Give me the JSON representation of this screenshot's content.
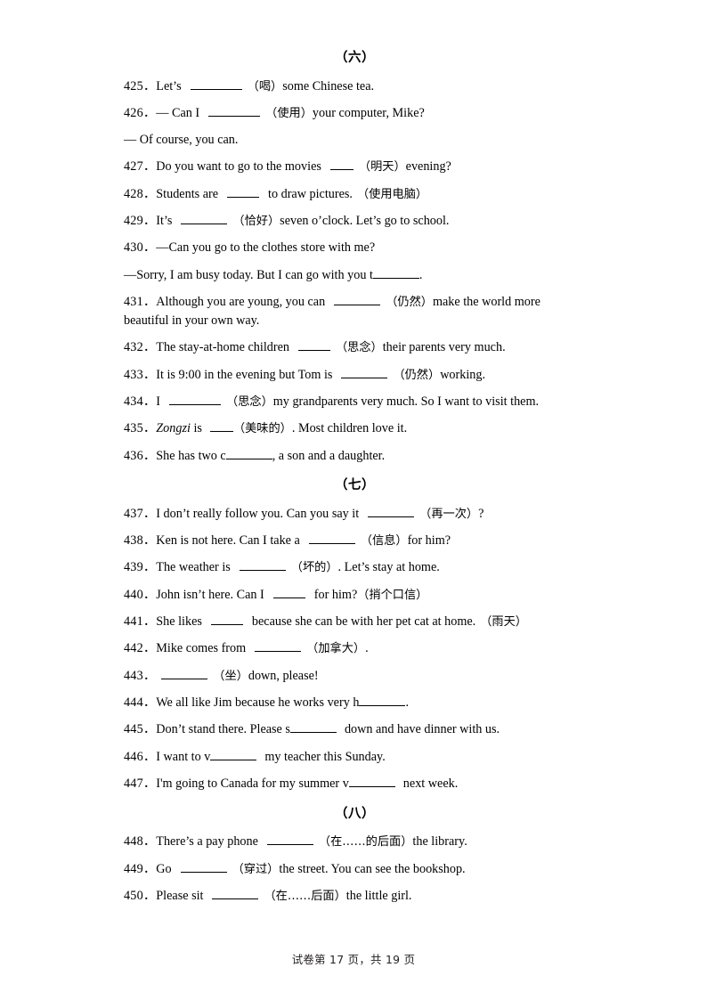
{
  "page": {
    "footer": "试卷第 17 页，共 19 页"
  },
  "sections": [
    {
      "header": "（六）",
      "items": [
        {
          "num": "425．",
          "pre": "Let’s",
          "blank": "b-xl",
          "post": "（喝）some Chinese tea."
        },
        {
          "num": "426．",
          "pre": "— Can I",
          "blank": "b-xl",
          "post": "（使用）your computer, Mike?"
        },
        {
          "num": "",
          "pre": "— Of course, you can.",
          "blank": "",
          "post": ""
        },
        {
          "num": "427．",
          "pre": "Do you want to go to the movies",
          "blank": "b-xs",
          "post": "（明天）evening?"
        },
        {
          "num": "428．",
          "pre": "Students are",
          "blank": "b-s",
          "post": "to draw pictures.（使用电脑）"
        },
        {
          "num": "429．",
          "pre": "It’s",
          "blank": "b-l",
          "post": "（恰好）seven o’clock. Let’s go to school."
        },
        {
          "num": "430．",
          "pre": "—Can you go to the clothes store with me?",
          "blank": "",
          "post": ""
        },
        {
          "num": "",
          "pre": "—Sorry, I am busy today. But I can go with you t",
          "blank": "b-l",
          "post": "."
        },
        {
          "num": "431．",
          "pre": "Although you are young, you can",
          "blank": "b-l",
          "post": "（仍然）make the world more beautiful in your own way."
        },
        {
          "num": "432．",
          "pre": "The stay-at-home children",
          "blank": "b-s",
          "post": "（思念）their parents very much."
        },
        {
          "num": "433．",
          "pre": "It is 9:00 in the evening but Tom is",
          "blank": "b-l",
          "post": "（仍然）working."
        },
        {
          "num": "434．",
          "pre": "I",
          "blank": "b-xl",
          "post": "（思念）my grandparents very much. So I want to visit them."
        },
        {
          "num": "435．",
          "pre": "Zongzi is",
          "blank": "b-xs",
          "post": "（美味的）. Most children love it."
        },
        {
          "num": "436．",
          "pre": "She has two c",
          "blank": "b-l",
          "post": ", a son and a daughter."
        }
      ]
    },
    {
      "header": "（七）",
      "items": [
        {
          "num": "437．",
          "pre": "I don’t really follow you. Can you say it",
          "blank": "b-l",
          "post": "（再一次）?"
        },
        {
          "num": "438．",
          "pre": "Ken is not here. Can I take a",
          "blank": "b-l",
          "post": "（信息）for him?"
        },
        {
          "num": "439．",
          "pre": "The weather is",
          "blank": "b-l",
          "post": "（坏的）. Let’s stay at home."
        },
        {
          "num": "440．",
          "pre": "John isn’t here. Can I",
          "blank": "b-s",
          "post": "for him?（捎个口信）"
        },
        {
          "num": "441．",
          "pre": "She likes",
          "blank": "b-s",
          "post": "because she can be with her pet cat at home.（雨天）"
        },
        {
          "num": "442．",
          "pre": "Mike comes from",
          "blank": "b-l",
          "post": "（加拿大）."
        },
        {
          "num": "443．",
          "pre": "",
          "blank": "b-l",
          "post": "（坐）down, please!"
        },
        {
          "num": "444．",
          "pre": "We all like Jim because he works very h",
          "blank": "b-l",
          "post": "."
        },
        {
          "num": "445．",
          "pre": "Don’t stand there. Please s",
          "blank": "b-l",
          "post": "down and have dinner with us."
        },
        {
          "num": "446．",
          "pre": "I want to v",
          "blank": "b-l",
          "post": "my teacher this Sunday."
        },
        {
          "num": "447．",
          "pre": "I'm going to Canada for my summer v",
          "blank": "b-l",
          "post": "next week."
        }
      ]
    },
    {
      "header": "（八）",
      "items": [
        {
          "num": "448．",
          "pre": "There’s a pay phone",
          "blank": "b-l",
          "post": "（在……的后面）the library."
        },
        {
          "num": "449．",
          "pre": "Go",
          "blank": "b-l",
          "post": "（穿过）the street. You can see the bookshop."
        },
        {
          "num": "450．",
          "pre": "Please sit",
          "blank": "b-l",
          "post": "（在……后面）the little girl."
        }
      ]
    }
  ],
  "lines": {
    "l425_num": "425．",
    "l425_a": "Let’s",
    "l425_b": "（喝）",
    "l425_c": "some Chinese tea.",
    "l426_num": "426．",
    "l426_a": "— Can I",
    "l426_b": "（使用）",
    "l426_c": "your computer, Mike?",
    "l426b": "— Of course, you can.",
    "l427_num": "427．",
    "l427_a": "Do you want to go to the movies",
    "l427_b": "（明天）",
    "l427_c": "evening?",
    "l428_num": "428．",
    "l428_a": "Students are",
    "l428_b": "to draw pictures.",
    "l428_c": "（使用电脑）",
    "l429_num": "429．",
    "l429_a": "It’s",
    "l429_b": "（恰好）",
    "l429_c": "seven o’clock. Let’s go to school.",
    "l430_num": "430．",
    "l430_a": "—Can you go to the clothes store with me?",
    "l430b_a": "—Sorry, I am busy today. But I can go with you t",
    "l430b_b": ".",
    "l431_num": "431．",
    "l431_a": "Although you are young, you can",
    "l431_b": "（仍然）",
    "l431_c": "make the world more beautiful in",
    "l431_d": "your own way.",
    "l432_num": "432．",
    "l432_a": "The stay-at-home children",
    "l432_b": "（思念）",
    "l432_c": "their parents very much.",
    "l433_num": "433．",
    "l433_a": "It is 9:00 in the evening but Tom is",
    "l433_b": "（仍然）",
    "l433_c": "working.",
    "l434_num": "434．",
    "l434_a": "I",
    "l434_b": "（思念）",
    "l434_c": "my grandparents very much. So I want to visit them.",
    "l435_num": "435．",
    "l435_a": "Zongzi",
    "l435_a2": "is",
    "l435_b": "（美味的）",
    "l435_c": ". Most children love it.",
    "l436_num": "436．",
    "l436_a": "She has two c",
    "l436_b": ", a son and a daughter.",
    "l437_num": "437．",
    "l437_a": "I don’t really follow you. Can you say it",
    "l437_b": "（再一次）",
    "l437_c": "?",
    "l438_num": "438．",
    "l438_a": "Ken is not here. Can I take a",
    "l438_b": "（信息）",
    "l438_c": "for him?",
    "l439_num": "439．",
    "l439_a": "The weather is",
    "l439_b": "（坏的）",
    "l439_c": ". Let’s stay at home.",
    "l440_num": "440．",
    "l440_a": "John isn’t here. Can I",
    "l440_b": "for him?",
    "l440_c": "（捎个口信）",
    "l441_num": "441．",
    "l441_a": "She likes",
    "l441_b": "because she can be with her pet cat at home.",
    "l441_c": "（雨天）",
    "l442_num": "442．",
    "l442_a": "Mike comes from",
    "l442_b": "（加拿大）",
    "l442_c": ".",
    "l443_num": "443．",
    "l443_b": "（坐）",
    "l443_c": "down, please!",
    "l444_num": "444．",
    "l444_a": "We all like Jim because he works very h",
    "l444_b": ".",
    "l445_num": "445．",
    "l445_a": "Don’t stand there. Please s",
    "l445_b": "down and have dinner with us.",
    "l446_num": "446．",
    "l446_a": "I want to v",
    "l446_b": "my teacher this Sunday.",
    "l447_num": "447．",
    "l447_a": "I'm going to Canada for my summer v",
    "l447_b": "next week.",
    "l448_num": "448．",
    "l448_a": "There’s a pay phone",
    "l448_b": "（在……的后面）",
    "l448_c": "the library.",
    "l449_num": "449．",
    "l449_a": "Go",
    "l449_b": "（穿过）",
    "l449_c": "the street. You can see the bookshop.",
    "l450_num": "450．",
    "l450_a": "Please sit",
    "l450_b": "（在……后面）",
    "l450_c": "the little girl."
  },
  "headers": {
    "six": "（六）",
    "seven": "（七）",
    "eight": "（八）"
  }
}
